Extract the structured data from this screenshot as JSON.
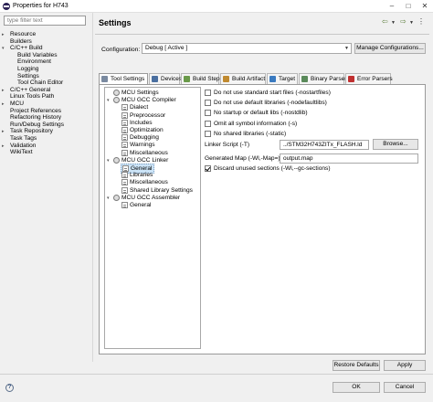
{
  "window": {
    "title": "Properties for H743"
  },
  "left_nav": {
    "filter_placeholder": "type filter text",
    "items": [
      {
        "label": "Resource",
        "indent": 1,
        "twisty": ">"
      },
      {
        "label": "Builders",
        "indent": 1,
        "twisty": ""
      },
      {
        "label": "C/C++ Build",
        "indent": 1,
        "twisty": "v"
      },
      {
        "label": "Build Variables",
        "indent": 2,
        "twisty": ""
      },
      {
        "label": "Environment",
        "indent": 2,
        "twisty": ""
      },
      {
        "label": "Logging",
        "indent": 2,
        "twisty": ""
      },
      {
        "label": "Settings",
        "indent": 2,
        "twisty": ""
      },
      {
        "label": "Tool Chain Editor",
        "indent": 2,
        "twisty": ""
      },
      {
        "label": "C/C++ General",
        "indent": 1,
        "twisty": ">"
      },
      {
        "label": "Linux Tools Path",
        "indent": 1,
        "twisty": ""
      },
      {
        "label": "MCU",
        "indent": 1,
        "twisty": ">"
      },
      {
        "label": "Project References",
        "indent": 1,
        "twisty": ""
      },
      {
        "label": "Refactoring History",
        "indent": 1,
        "twisty": ""
      },
      {
        "label": "Run/Debug Settings",
        "indent": 1,
        "twisty": ""
      },
      {
        "label": "Task Repository",
        "indent": 1,
        "twisty": ">"
      },
      {
        "label": "Task Tags",
        "indent": 1,
        "twisty": ""
      },
      {
        "label": "Validation",
        "indent": 1,
        "twisty": ">"
      },
      {
        "label": "WikiText",
        "indent": 1,
        "twisty": ""
      }
    ]
  },
  "main": {
    "title": "Settings",
    "configuration_label": "Configuration:",
    "configuration_value": "Debug  [ Active ]",
    "manage_button": "Manage Configurations...",
    "tabs": [
      {
        "label": "Tool Settings",
        "color": "#7a8aa0"
      },
      {
        "label": "Devices",
        "color": "#4a6fa0"
      },
      {
        "label": "Build Steps",
        "color": "#6a9a4a"
      },
      {
        "label": "Build Artifact",
        "color": "#c08a30"
      },
      {
        "label": "Target",
        "color": "#3a7ac0"
      },
      {
        "label": "Binary Parsers",
        "color": "#5a8a5a"
      },
      {
        "label": "Error Parsers",
        "color": "#c03030"
      }
    ],
    "tool_tree": [
      {
        "label": "MCU Settings",
        "level": 1,
        "icon": "gear",
        "twisty": ""
      },
      {
        "label": "MCU GCC Compiler",
        "level": 1,
        "icon": "gear",
        "twisty": "v"
      },
      {
        "label": "Dialect",
        "level": 2,
        "icon": "page",
        "twisty": ""
      },
      {
        "label": "Preprocessor",
        "level": 2,
        "icon": "page",
        "twisty": ""
      },
      {
        "label": "Includes",
        "level": 2,
        "icon": "page",
        "twisty": ""
      },
      {
        "label": "Optimization",
        "level": 2,
        "icon": "page",
        "twisty": ""
      },
      {
        "label": "Debugging",
        "level": 2,
        "icon": "page",
        "twisty": ""
      },
      {
        "label": "Warnings",
        "level": 2,
        "icon": "page",
        "twisty": ""
      },
      {
        "label": "Miscellaneous",
        "level": 2,
        "icon": "page",
        "twisty": ""
      },
      {
        "label": "MCU GCC Linker",
        "level": 1,
        "icon": "gear",
        "twisty": "v"
      },
      {
        "label": "General",
        "level": 2,
        "icon": "page",
        "twisty": "",
        "selected": true
      },
      {
        "label": "Libraries",
        "level": 2,
        "icon": "page",
        "twisty": ""
      },
      {
        "label": "Miscellaneous",
        "level": 2,
        "icon": "page",
        "twisty": ""
      },
      {
        "label": "Shared Library Settings",
        "level": 2,
        "icon": "page",
        "twisty": ""
      },
      {
        "label": "MCU GCC Assembler",
        "level": 1,
        "icon": "gear",
        "twisty": "v"
      },
      {
        "label": "General",
        "level": 2,
        "icon": "page",
        "twisty": ""
      }
    ],
    "options": [
      {
        "label": "Do not use standard start files (-nostartfiles)",
        "checked": false
      },
      {
        "label": "Do not use default libraries (-nodefaultlibs)",
        "checked": false
      },
      {
        "label": "No startup or default libs (-nostdlib)",
        "checked": false
      },
      {
        "label": "Omit all symbol information (-s)",
        "checked": false
      },
      {
        "label": "No shared libraries (-static)",
        "checked": false
      }
    ],
    "linker_script_label": "Linker Script (-T)",
    "linker_script_value": "../STM32H743ZITx_FLASH.ld",
    "browse_button": "Browse...",
    "generated_map_label": "Generated Map (-Wl,-Map=)",
    "generated_map_value": "output.map",
    "discard_label": "Discard unused sections (-Wl,--gc-sections)",
    "discard_checked": true
  },
  "footer": {
    "restore_defaults": "Restore Defaults",
    "apply": "Apply",
    "ok": "OK",
    "cancel": "Cancel"
  }
}
